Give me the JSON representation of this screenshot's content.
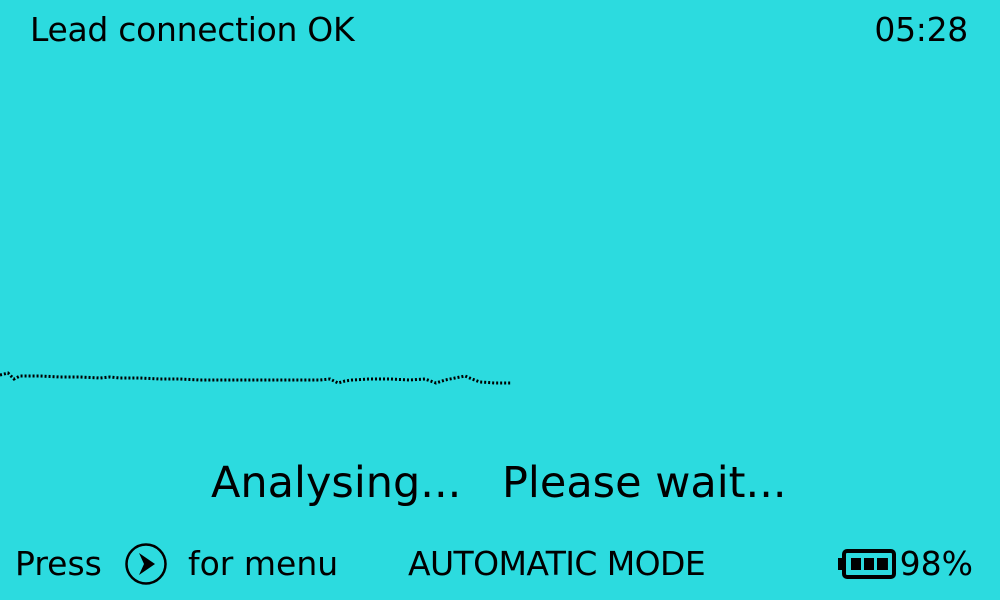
{
  "status": {
    "lead_message": "Lead connection OK",
    "clock": "05:28"
  },
  "main": {
    "analysing_text": "Analysing...",
    "please_wait_text": "Please wait..."
  },
  "footer": {
    "press_label": "Press",
    "menu_label": "for menu",
    "menu_button_icon": "chevron-right-circle-icon",
    "mode_label": "AUTOMATIC MODE",
    "battery_icon": "battery-icon",
    "battery_percent": "98%",
    "battery_level": 0.98
  },
  "colors": {
    "background": "#2cdbdf",
    "foreground": "#000000"
  }
}
